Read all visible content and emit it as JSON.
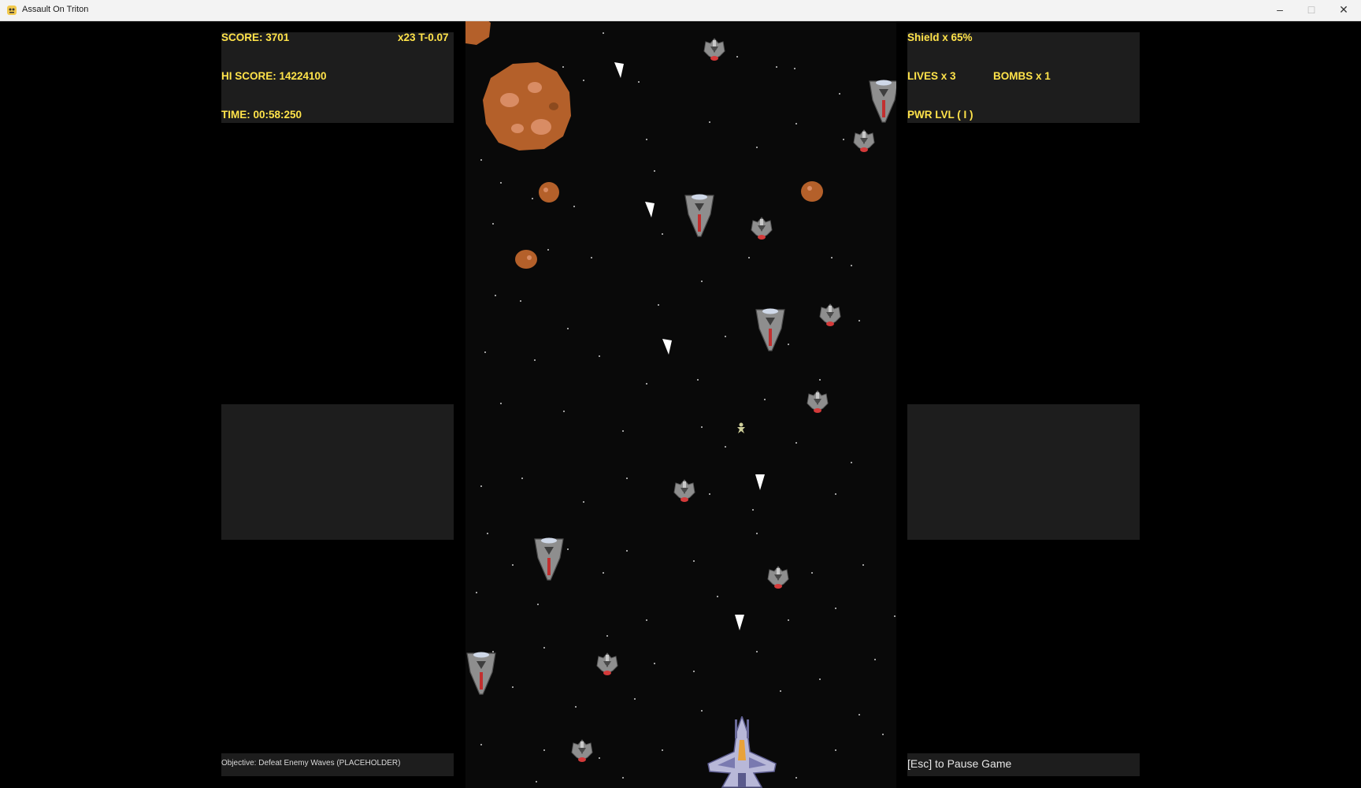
{
  "window": {
    "title": "Assault On Triton",
    "minimize_icon": "minimize-icon",
    "maximize_icon": "maximize-icon",
    "close_icon": "close-icon"
  },
  "hud": {
    "score": "SCORE: 3701",
    "multiplier": "x23 T-0.07",
    "hi_score": "HI SCORE: 14224100",
    "time": "TIME: 00:58:250",
    "shield": "Shield x 65%",
    "lives": "LIVES x 3",
    "bombs": "BOMBS x 1",
    "power_level": "PWR LVL ( I )",
    "objective": "Objective: Defeat Enemy Waves (PLACEHOLDER)",
    "pause_hint": "[Esc] to Pause Game"
  },
  "colors": {
    "hud_text": "#ffe34a",
    "panel": "#1d1d1d",
    "playfield": "#090909",
    "asteroid": "#b4602a",
    "enemy": "#8e8e8e",
    "player": "#b8b8d8"
  }
}
